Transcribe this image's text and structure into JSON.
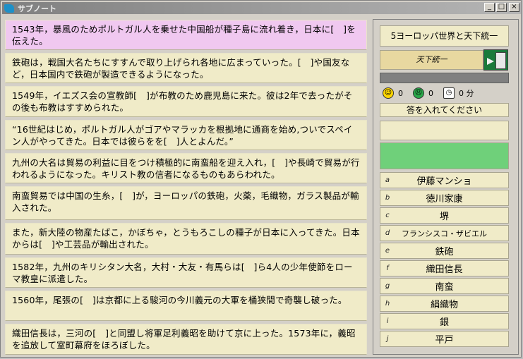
{
  "window": {
    "title": "サブノート"
  },
  "questions": [
    {
      "text": "1543年，暴風のためポルトガル人を乗せた中国船が種子島に流れ着き，日本に[　]を伝えた。",
      "active": true
    },
    {
      "text": "鉄砲は，戦国大名たちにすすんで取り上げられ各地に広まっていった。[　]や国友など，日本国内で鉄砲が製造できるようになった。"
    },
    {
      "text": "1549年，イエズス会の宣教師[　]が布教のため鹿児島に来た。彼は2年で去ったがその後も布教はすすめられた。"
    },
    {
      "text": "“16世紀はじめ，ポルトガル人がゴアやマラッカを根拠地に通商を始め,ついでスペイン人がやってきた。日本では彼らをを[　]人とよんだ。”"
    },
    {
      "text": "九州の大名は貿易の利益に目をつけ積極的に南蛮船を迎え入れ，[　]や長崎で貿易が行われるようになった。キリスト教の信者になるものもあらわれた。"
    },
    {
      "text": "南蛮貿易では中国の生糸，[　]が，ヨーロッパの鉄砲，火薬，毛織物，ガラス製品が輸入された。"
    },
    {
      "text": "また，新大陸の物産たばこ，かぼちゃ，とうもろこしの種子が日本に入ってきた。日本からは[　]や工芸品が輸出された。"
    },
    {
      "text": "1582年，九州のキリシタン大名，大村・大友・有馬らは[　]ら4人の少年使節をローマ教皇に派遣した。"
    },
    {
      "text": "1560年，尾張の[　]は京都に上る駿河の今川義元の大軍を桶狭間で奇襲し破った。"
    },
    {
      "text": "織田信長は，三河の[　]と同盟し将軍足利義昭を助けて京に上った。1573年に，義昭を追放して室町幕府をほろぼした。"
    }
  ],
  "panel": {
    "lesson_title": "5ヨーロッパ世界と天下統一",
    "mode": "天下統一",
    "correct_count": "0",
    "wrong_count": "0",
    "time": "0 分",
    "prompt": "答を入れてください",
    "answer": "",
    "choices": [
      {
        "key": "a",
        "label": "伊藤マンショ"
      },
      {
        "key": "b",
        "label": "徳川家康"
      },
      {
        "key": "c",
        "label": "堺"
      },
      {
        "key": "d",
        "label": "フランシスコ・ザビエル"
      },
      {
        "key": "e",
        "label": "鉄砲"
      },
      {
        "key": "f",
        "label": "織田信長"
      },
      {
        "key": "g",
        "label": "南蛮"
      },
      {
        "key": "h",
        "label": "絹織物"
      },
      {
        "key": "i",
        "label": "銀"
      },
      {
        "key": "j",
        "label": "平戸"
      }
    ]
  },
  "colors": {
    "active_question": "#f0c8f0",
    "question_bg": "#f0ebc8",
    "feedback": "#6fd07a"
  }
}
